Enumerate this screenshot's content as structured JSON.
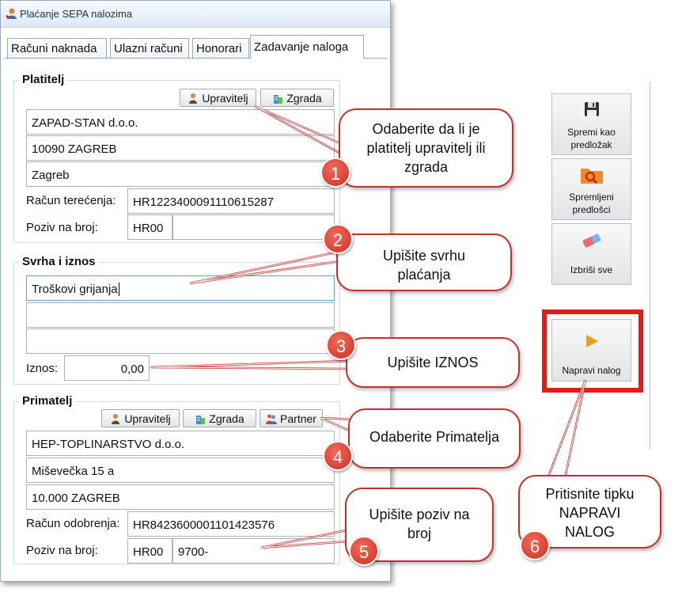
{
  "window": {
    "title": "Plaćanje SEPA nalozima"
  },
  "tabs": [
    {
      "label": "Računi naknada"
    },
    {
      "label": "Ulazni računi"
    },
    {
      "label": "Honorari"
    },
    {
      "label": "Zadavanje naloga",
      "active": true
    }
  ],
  "platitelj": {
    "legend": "Platitelj",
    "btn_upravitelj": "Upravitelj",
    "btn_zgrada": "Zgrada",
    "name": "ZAPAD-STAN d.o.o.",
    "city": "10090 ZAGREB",
    "place": "Zagreb",
    "racun_label": "Račun terećenja:",
    "racun": "HR1223400091110615287",
    "poziv_label": "Poziv na broj:",
    "poziv_model": "HR00",
    "poziv_broj": ""
  },
  "svrha": {
    "legend": "Svrha i iznos",
    "line1": "Troškovi grijanja",
    "line2": "",
    "line3": "",
    "iznos_label": "Iznos:",
    "iznos": "0,00"
  },
  "primatelj": {
    "legend": "Primatelj",
    "btn_upravitelj": "Upravitelj",
    "btn_zgrada": "Zgrada",
    "btn_partner": "Partner",
    "name": "HEP-TOPLINARSTVO d.o.o.",
    "street": "Miševečka 15 a",
    "city": "10.000 ZAGREB",
    "racun_label": "Račun odobrenja:",
    "racun": "HR8423600001101423576",
    "poziv_label": "Poziv na broj:",
    "poziv_model": "HR00",
    "poziv_broj": "9700-"
  },
  "toolbar": {
    "spremi_kao": "Spremi kao predložak",
    "spremljeni": "Spremljeni predlošci",
    "izbrisi": "Izbriši sve",
    "napravi": "Napravi nalog"
  },
  "callouts": [
    {
      "num": "1",
      "text": "Odaberite da li je platitelj upravitelj ili zgrada"
    },
    {
      "num": "2",
      "text": "Upišite svrhu plaćanja"
    },
    {
      "num": "3",
      "text": "Upišite IZNOS"
    },
    {
      "num": "4",
      "text": "Odaberite Primatelja"
    },
    {
      "num": "5",
      "text": "Upišite poziv na broj"
    },
    {
      "num": "6",
      "text": "Pritisnite tipku NAPRAVI NALOG"
    }
  ],
  "colors": {
    "callout_border": "#c0312f",
    "highlight": "#e01c1c",
    "badge": "#d9372a"
  }
}
